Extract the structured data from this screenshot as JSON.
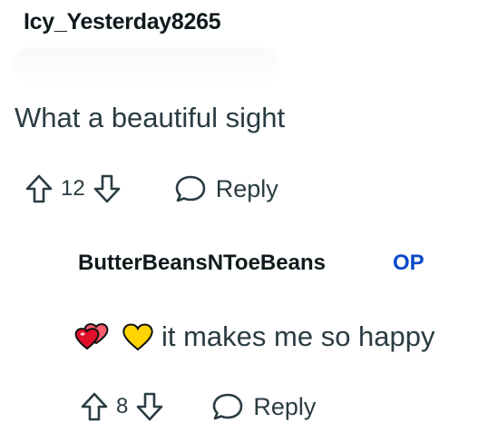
{
  "comment": {
    "author": "Icy_Yesterday8265",
    "text": "What a beautiful sight",
    "upvotes": "12",
    "reply_label": "Reply"
  },
  "reply": {
    "author": "ButterBeansNToeBeans",
    "badge": "OP",
    "emojis": [
      "two-hearts-icon",
      "yellow-heart-icon"
    ],
    "text": "it makes me so happy",
    "upvotes": "8",
    "reply_label": "Reply"
  },
  "colors": {
    "text": "#2a3c42",
    "username": "#0f1a1c",
    "op_badge": "#0a49c9",
    "heart_red": "#e0102a",
    "heart_yellow": "#ffd400"
  }
}
